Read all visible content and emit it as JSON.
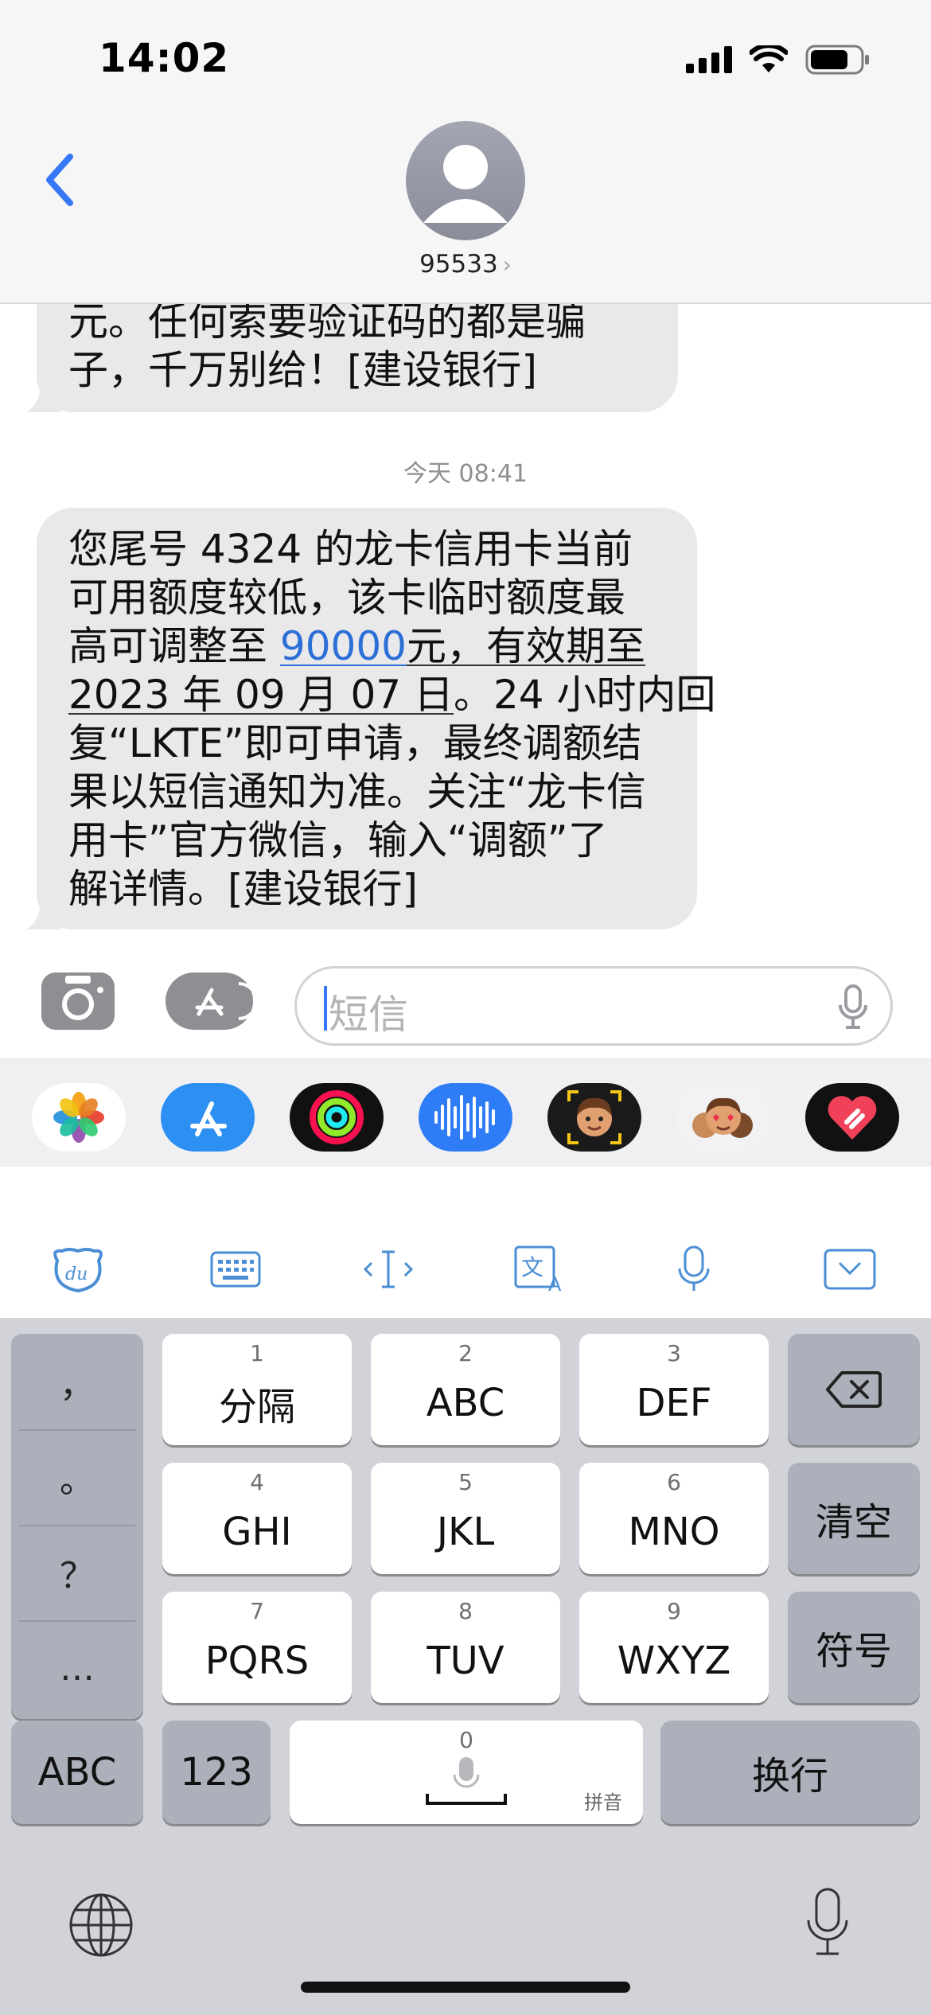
{
  "status_bar": {
    "time": "14:02"
  },
  "header": {
    "contact": "95533",
    "chevron": "›"
  },
  "messages": {
    "prev_lines": [
      "元。任何索要验证码的都是骗",
      "子，千万别给！[建设银行]"
    ],
    "timestamp": "今天 08:41",
    "msg": {
      "l1": "您尾号 4324 的龙卡信用卡当前",
      "l2": "可用额度较低，该卡临时额度最",
      "l3_pre": "高可调整至 ",
      "l3_link": "90000",
      "l3_post": "元，有效期至",
      "l4_date": "2023 年 09 月 07 日",
      "l4_post": "。24 小时内回",
      "l5": "复“LKTE”即可申请，最终调额结",
      "l6": "果以短信通知为准。关注“龙卡信",
      "l7": "用卡”官方微信，输入“调额”了",
      "l8": "解详情。[建设银行]"
    }
  },
  "compose": {
    "placeholder": "短信"
  },
  "keyboard": {
    "punct": [
      "，",
      "。",
      "？",
      "…"
    ],
    "keys": [
      {
        "num": "1",
        "label": "分隔"
      },
      {
        "num": "2",
        "label": "ABC"
      },
      {
        "num": "3",
        "label": "DEF"
      },
      {
        "num": "4",
        "label": "GHI"
      },
      {
        "num": "5",
        "label": "JKL"
      },
      {
        "num": "6",
        "label": "MNO"
      },
      {
        "num": "7",
        "label": "PQRS"
      },
      {
        "num": "8",
        "label": "TUV"
      },
      {
        "num": "9",
        "label": "WXYZ"
      }
    ],
    "clear": "清空",
    "symbols": "符号",
    "abc": "ABC",
    "num123": "123",
    "space_num": "0",
    "space_sub": "拼音",
    "return": "换行"
  },
  "colors": {
    "link": "#2c6fd6",
    "bubble": "#e9e9eb",
    "keyboard_bg": "#d1d3d9"
  }
}
